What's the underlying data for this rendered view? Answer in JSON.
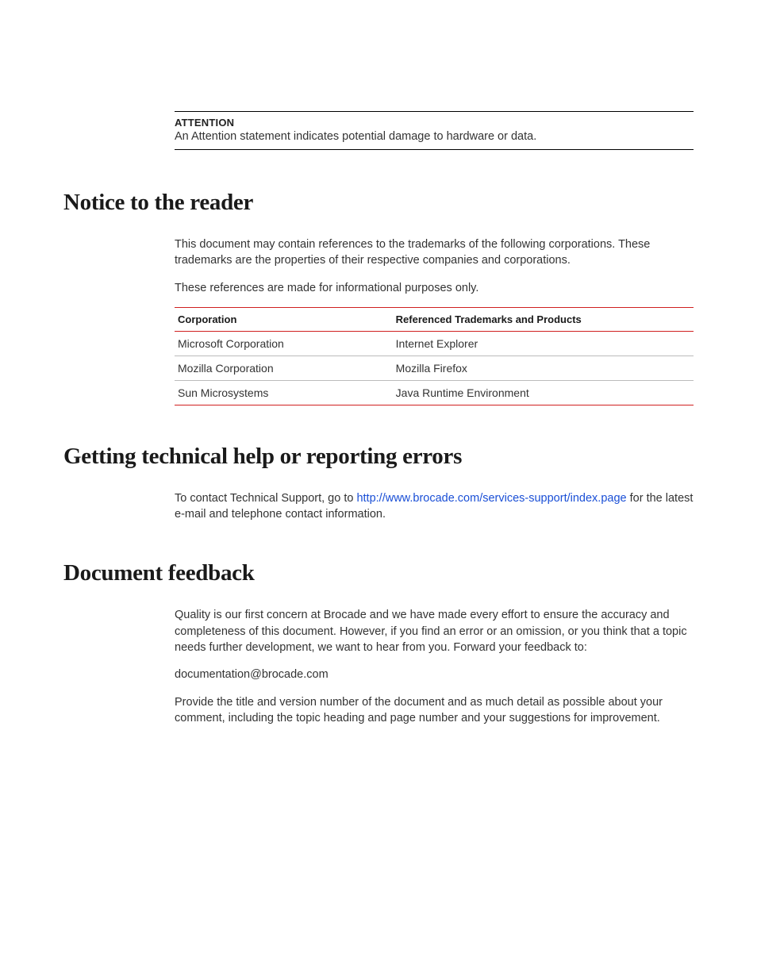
{
  "attention": {
    "label": "ATTENTION",
    "text": "An Attention statement indicates potential damage to hardware or data."
  },
  "notice": {
    "heading": "Notice to the reader",
    "p1": "This document may contain references to the trademarks of the following corporations. These trademarks are the properties of their respective companies and corporations.",
    "p2": "These references are made for informational purposes only.",
    "table": {
      "headers": {
        "c1": "Corporation",
        "c2": "Referenced Trademarks and Products"
      },
      "rows": [
        {
          "c1": "Microsoft Corporation",
          "c2": "Internet Explorer"
        },
        {
          "c1": "Mozilla Corporation",
          "c2": "Mozilla Firefox"
        },
        {
          "c1": "Sun Microsystems",
          "c2": "Java Runtime Environment"
        }
      ]
    }
  },
  "support": {
    "heading": "Getting technical help or reporting errors",
    "pre_link": "To contact Technical Support, go to ",
    "link_text": "http://www.brocade.com/services-support/index.page",
    "post_link": " for the latest e-mail and telephone contact information."
  },
  "feedback": {
    "heading": "Document feedback",
    "p1": "Quality is our first concern at Brocade and we have made every effort to ensure the accuracy and completeness of this document. However, if you find an error or an omission, or you think that a topic needs further development, we want to hear from you. Forward your feedback to:",
    "email": "documentation@brocade.com",
    "p2": "Provide the title and version number of the document and as much detail as possible about your comment, including the topic heading and page number and your suggestions for improvement."
  }
}
